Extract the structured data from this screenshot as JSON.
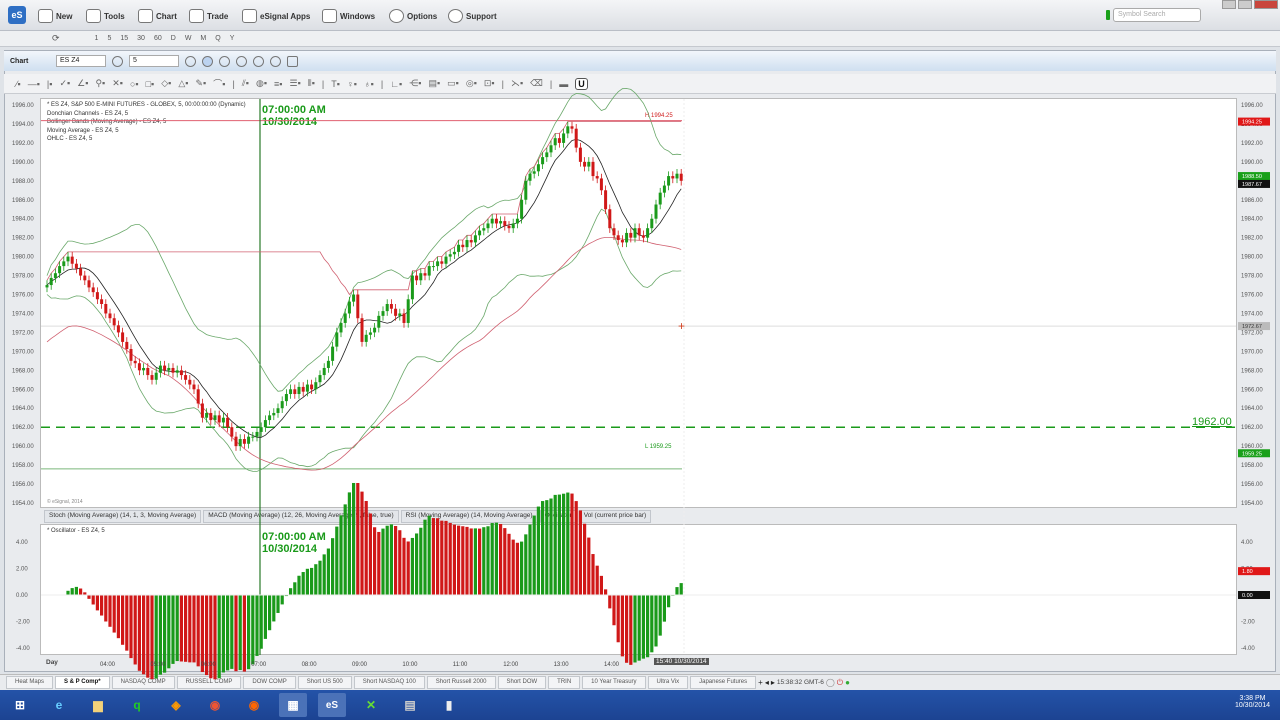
{
  "menu": {
    "items": [
      "New",
      "Tools",
      "Chart",
      "Trade",
      "eSignal Apps",
      "Windows",
      "Options",
      "Support"
    ],
    "logo": "eS",
    "search_placeholder": "Symbol Search"
  },
  "intervals": [
    "1",
    "5",
    "15",
    "30",
    "60",
    "D",
    "W",
    "M",
    "Q",
    "Y"
  ],
  "chart_window": {
    "title": "Chart",
    "symbol": "ES Z4",
    "interval": "5",
    "lock_button": "U"
  },
  "legend": [
    "* ES Z4, S&P 500 E-MINI FUTURES - GLOBEX, 5, 00:00:00:00 (Dynamic)",
    "Donchian Channels - ES Z4, 5",
    "Bollinger Bands (Moving Average) - ES Z4, 5",
    "Moving Average - ES Z4, 5",
    "OHLC - ES Z4, 5"
  ],
  "cursor": {
    "time": "07:00:00 AM",
    "date": "10/30/2014"
  },
  "watermark": "© eSignal, 2014",
  "price_labels": {
    "high": "H 1994.25",
    "low": "L 1959.25",
    "hline": "1962.00",
    "markers": [
      {
        "v": "1994.25",
        "color": "#e01818"
      },
      {
        "v": "1988.50",
        "color": "#1aa01a"
      },
      {
        "v": "1987.67",
        "color": "#111111"
      },
      {
        "v": "1972.67",
        "color": "#bbbbbb"
      },
      {
        "v": "1959.25",
        "color": "#1aa01a"
      }
    ]
  },
  "study_tabs": [
    "Stoch (Moving Average) (14, 1, 3, Moving Average)",
    "MACD (Moving Average) (12, 26, Moving Average, 9, false, true)",
    "RSI (Moving Average) (14, Moving Average)",
    "Oscillator",
    "Vol (current price bar)"
  ],
  "active_study_tab": 3,
  "oscillator": {
    "legend": "* Oscillator - ES Z4, 5",
    "markers": [
      {
        "v": "1.80",
        "color": "#e01818"
      },
      {
        "v": "0.00",
        "color": "#111111"
      }
    ]
  },
  "time_axis": {
    "day_label": "Day",
    "labels": [
      "04:00",
      "05:00",
      "06:00",
      "07:00",
      "08:00",
      "09:00",
      "10:00",
      "11:00",
      "12:00",
      "13:00",
      "14:00"
    ],
    "current": "15:40 10/30/2014"
  },
  "page_tabs": [
    "Heat Maps",
    "S & P Comp*",
    "NASDAQ COMP",
    "RUSSELL COMP",
    "DOW COMP",
    "Short US 500",
    "Short NASDAQ 100",
    "Short Russell 2000",
    "Short DOW",
    "TRIN",
    "10 Year Treasury",
    "Ultra Vix",
    "Japanese Futures"
  ],
  "active_page_tab": 1,
  "status_time": "15:38:32 GMT-6",
  "taskbar": {
    "time": "3:38 PM",
    "date": "10/30/2014"
  },
  "chart_data": {
    "type": "candlestick",
    "symbol": "ES Z4",
    "bar_interval_min": 5,
    "first_bar_time": "03:15",
    "ylim": [
      1954,
      1996
    ],
    "yticks": [
      1996,
      1994,
      1992,
      1990,
      1988,
      1986,
      1984,
      1982,
      1980,
      1978,
      1976,
      1974,
      1972,
      1970,
      1968,
      1966,
      1964,
      1962,
      1960,
      1958,
      1956,
      1954
    ],
    "osc_ylim": [
      -5,
      5
    ],
    "osc_ticks": [
      "4.00",
      "2.00",
      "0.00",
      "-2.00",
      "-4.00"
    ],
    "hline": 1962.0,
    "high": 1994.25,
    "low": 1959.25,
    "crosshair_price": 1972.67,
    "closes": [
      1977,
      1977.75,
      1978.25,
      1979,
      1979.5,
      1980,
      1979.25,
      1978.75,
      1978,
      1977.5,
      1976.75,
      1976.25,
      1975.5,
      1975,
      1974,
      1973.5,
      1972.75,
      1972,
      1971,
      1970.25,
      1969,
      1968.75,
      1968,
      1968.25,
      1967.5,
      1967,
      1967.75,
      1968.5,
      1968,
      1968.25,
      1967.75,
      1968,
      1967.5,
      1967,
      1966.5,
      1966,
      1964.5,
      1963,
      1963.5,
      1962.75,
      1963.25,
      1962.5,
      1963,
      1962,
      1961,
      1960,
      1960.75,
      1960.25,
      1961,
      1961,
      1961.5,
      1962,
      1962.75,
      1963.25,
      1963.5,
      1964,
      1964.75,
      1965.5,
      1966,
      1965.5,
      1966.25,
      1965.75,
      1966.5,
      1966,
      1966.75,
      1967.5,
      1968.25,
      1969,
      1970.5,
      1972,
      1973,
      1974,
      1975.25,
      1976,
      1973.5,
      1971,
      1971.75,
      1972,
      1972.5,
      1973.75,
      1974.25,
      1975,
      1974.5,
      1973.75,
      1974,
      1973,
      1975.5,
      1978,
      1977.5,
      1978.25,
      1978,
      1979,
      1979,
      1979.5,
      1979.25,
      1980,
      1980.25,
      1980.5,
      1981.25,
      1981,
      1981.75,
      1981.5,
      1982.25,
      1982.75,
      1983,
      1983.5,
      1984,
      1983.5,
      1983.75,
      1983.25,
      1983,
      1983.5,
      1984,
      1986,
      1988,
      1988.75,
      1989,
      1989.75,
      1990.5,
      1991,
      1991.75,
      1992.5,
      1992,
      1993,
      1993.75,
      1993.5,
      1991.5,
      1990,
      1989.5,
      1990,
      1988.5,
      1988.25,
      1987,
      1985,
      1983,
      1982.25,
      1981.75,
      1981.5,
      1982.5,
      1982,
      1983,
      1982.25,
      1982,
      1983,
      1984,
      1985.5,
      1986.75,
      1987.5,
      1988.5,
      1988.25,
      1988.75,
      1988
    ]
  }
}
